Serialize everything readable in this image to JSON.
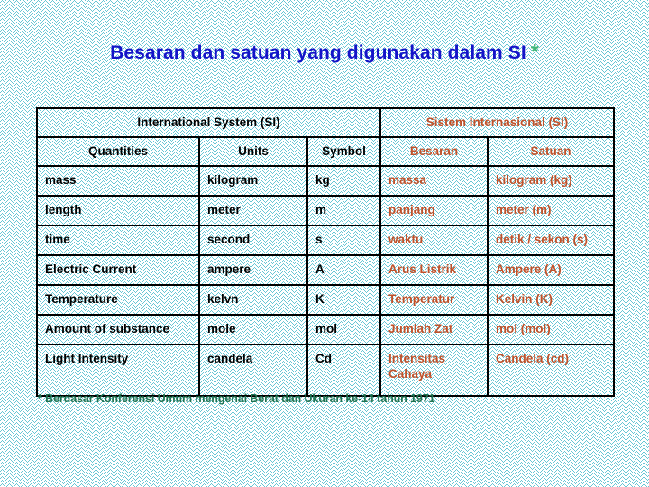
{
  "slide": {
    "title_text": "Besaran dan satuan yang digunakan dalam SI",
    "title_star": "*",
    "footnote": "* Berdasar Konferensi Umum mengenai Berat dan Ukuran ke-14 tahun 1971",
    "colors": {
      "title": "#1414c8",
      "star": "#3fb878",
      "english_text": "#000000",
      "indonesian_text": "#c0512a",
      "footnote": "#1f7351",
      "border": "#000000",
      "pattern": "#67c6d4",
      "background": "#ffffff"
    }
  },
  "table": {
    "group_headers": [
      {
        "label": "International System (SI)",
        "span": 3
      },
      {
        "label": "Sistem Internasional (SI)",
        "span": 2
      }
    ],
    "column_headers": [
      "Quantities",
      "Units",
      "Symbol",
      "Besaran",
      "Satuan"
    ],
    "rows": [
      {
        "quantity": "mass",
        "unit": "kilogram",
        "symbol": "kg",
        "besaran": "massa",
        "satuan": "kilogram (kg)"
      },
      {
        "quantity": "length",
        "unit": "meter",
        "symbol": "m",
        "besaran": "panjang",
        "satuan": "meter (m)"
      },
      {
        "quantity": "time",
        "unit": "second",
        "symbol": "s",
        "besaran": "waktu",
        "satuan": "detik / sekon (s)"
      },
      {
        "quantity": "Electric Current",
        "unit": "ampere",
        "symbol": "A",
        "besaran": "Arus Listrik",
        "satuan": "Ampere (A)"
      },
      {
        "quantity": "Temperature",
        "unit": "kelvn",
        "symbol": "K",
        "besaran": "Temperatur",
        "satuan": "Kelvin (K)"
      },
      {
        "quantity": "Amount of substance",
        "unit": "mole",
        "symbol": "mol",
        "besaran": "Jumlah Zat",
        "satuan": "mol (mol)"
      },
      {
        "quantity": "Light Intensity",
        "unit": "candela",
        "symbol": "Cd",
        "besaran": "Intensitas Cahaya",
        "satuan": "Candela (cd)"
      }
    ]
  }
}
